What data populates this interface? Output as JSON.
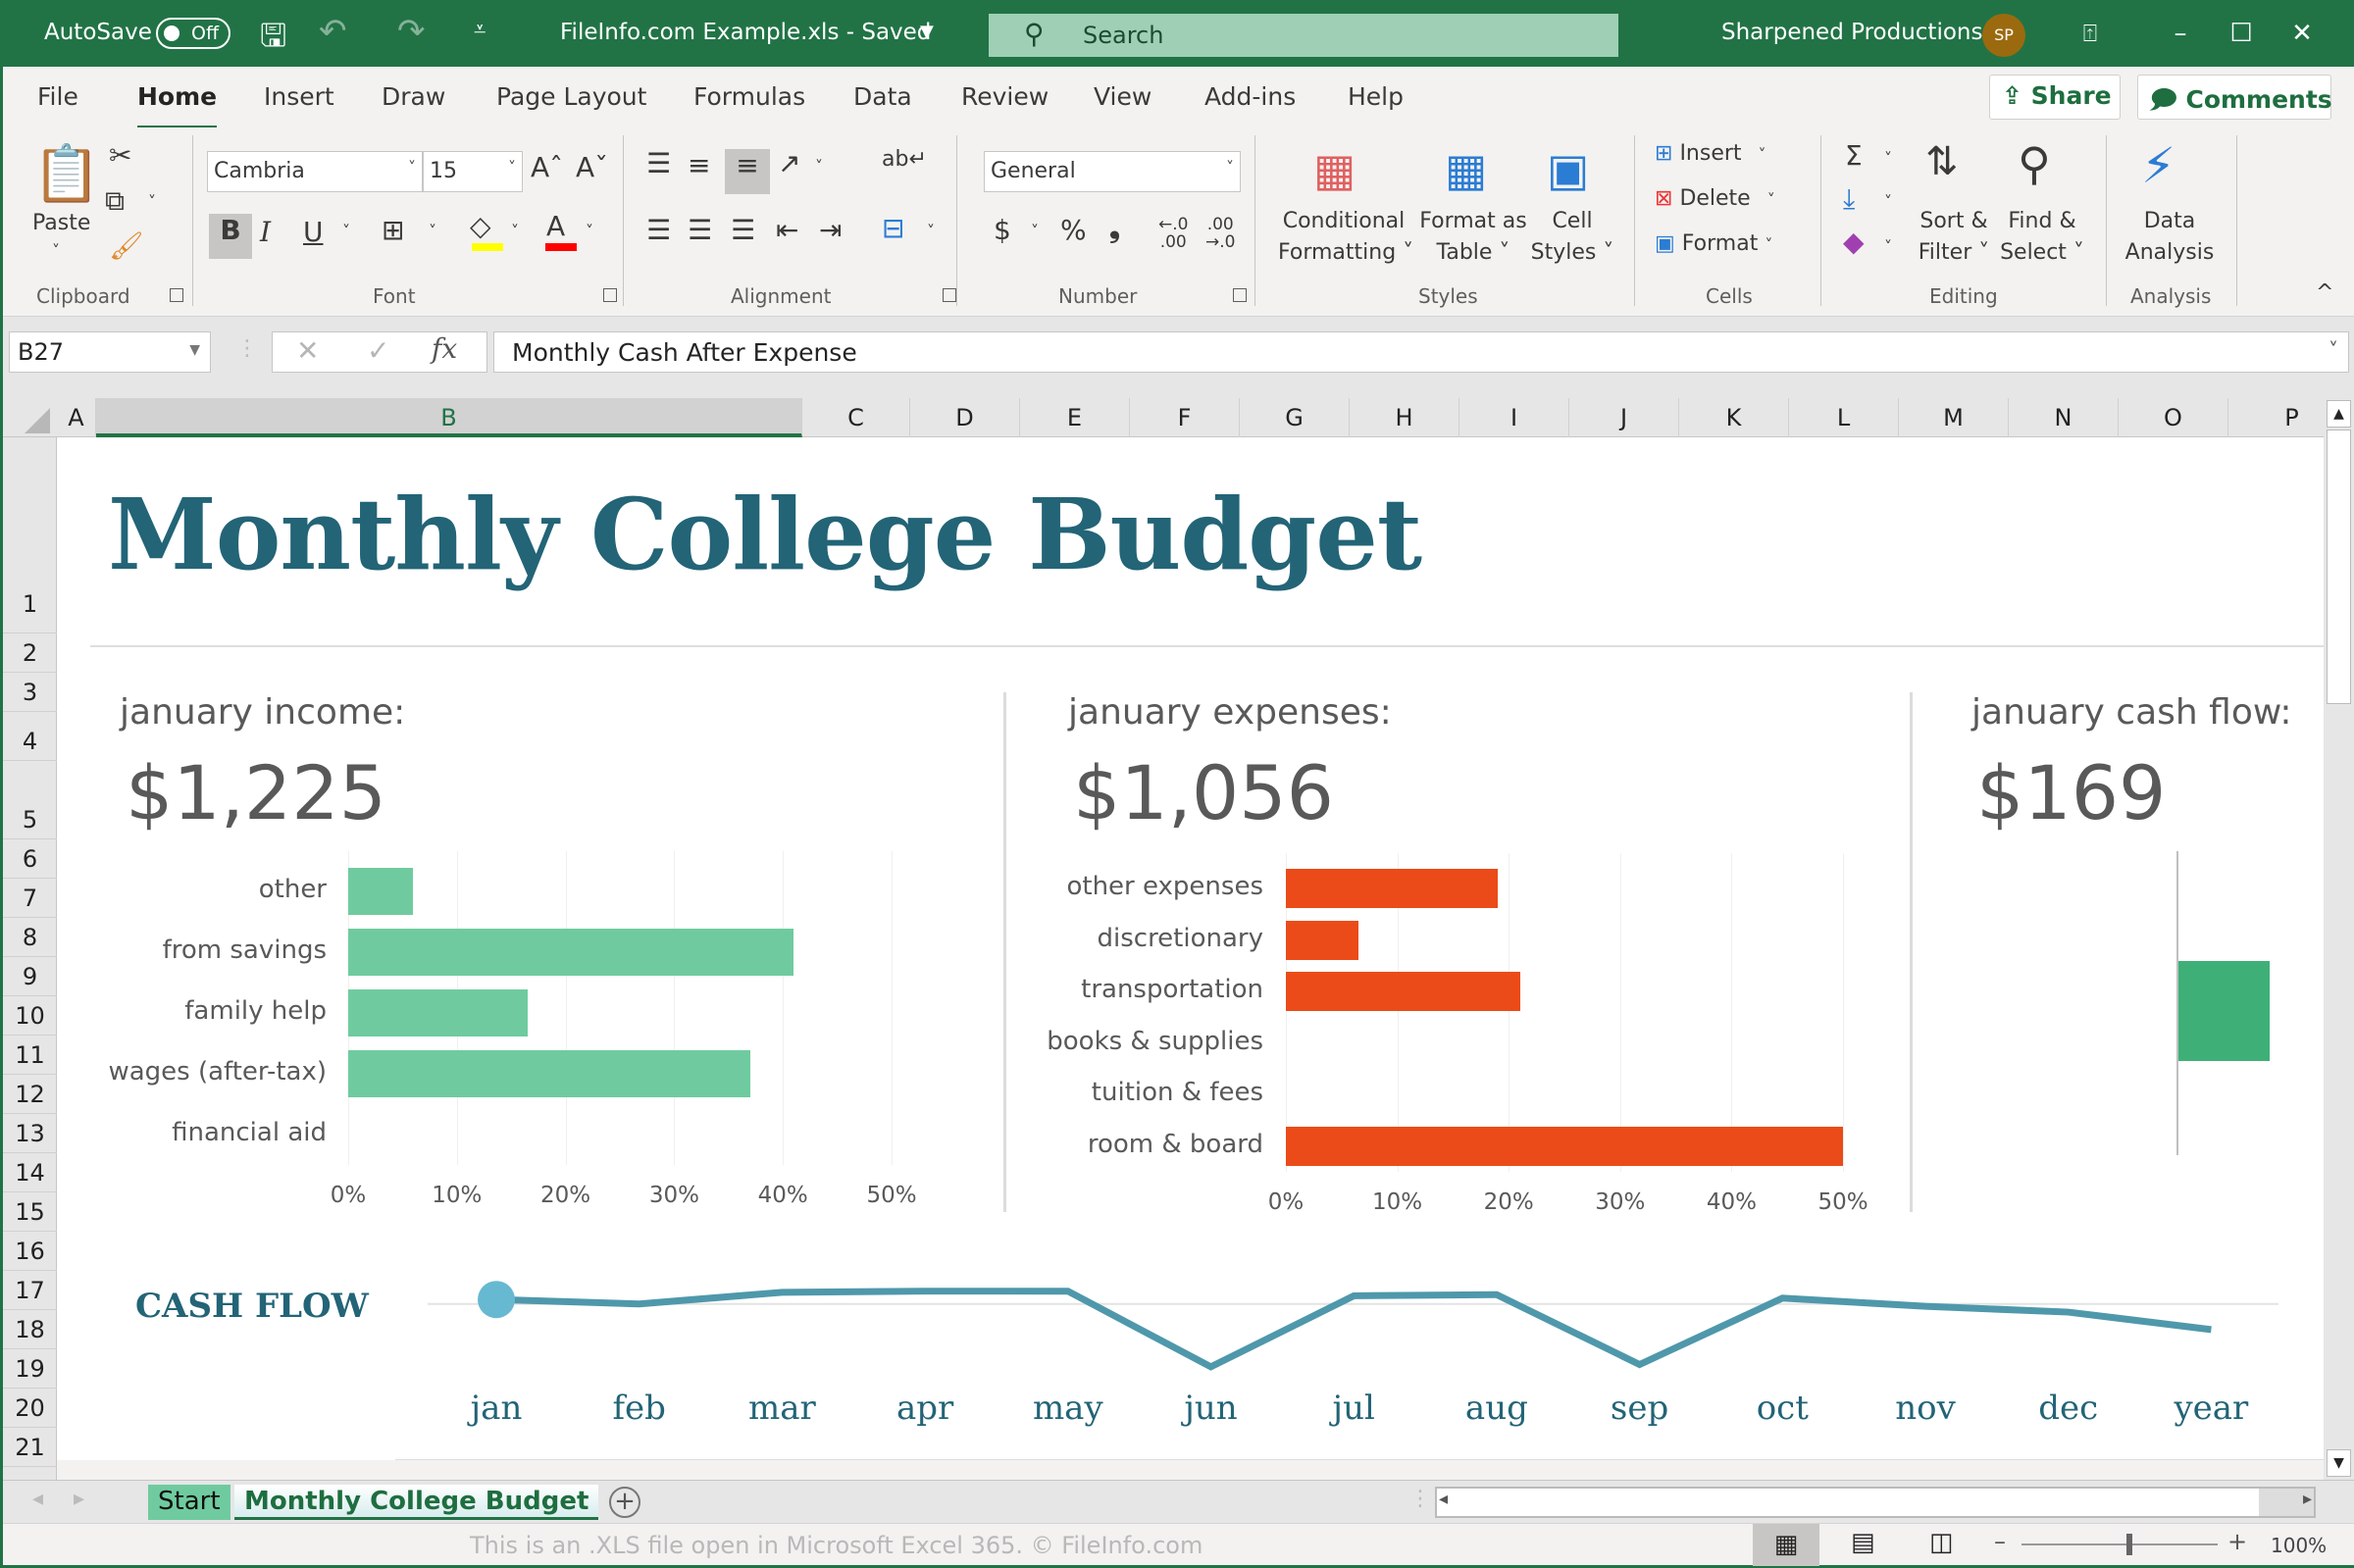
{
  "titlebar": {
    "autosave_label": "AutoSave",
    "autosave_state": "Off",
    "doc_title": "FileInfo.com Example.xls  -  Saved",
    "search_placeholder": "Search",
    "user_name": "Sharpened Productions",
    "user_initials": "SP",
    "colors": {
      "bar": "#217346",
      "search": "#9fd0b5",
      "avatar": "#9b6a0e"
    }
  },
  "menu": {
    "tabs": [
      {
        "label": "File"
      },
      {
        "label": "Home",
        "active": true
      },
      {
        "label": "Insert"
      },
      {
        "label": "Draw"
      },
      {
        "label": "Page Layout"
      },
      {
        "label": "Formulas"
      },
      {
        "label": "Data"
      },
      {
        "label": "Review"
      },
      {
        "label": "View"
      },
      {
        "label": "Add-ins"
      },
      {
        "label": "Help"
      }
    ],
    "share_label": "Share",
    "comments_label": "Comments"
  },
  "ribbon": {
    "clipboard": {
      "label": "Clipboard",
      "paste": "Paste"
    },
    "font": {
      "label": "Font",
      "font_name": "Cambria",
      "font_size": "15",
      "bold": "B",
      "italic": "I",
      "underline": "U",
      "fill_color": "#ffff00",
      "font_color": "#ff0000"
    },
    "alignment": {
      "label": "Alignment"
    },
    "number": {
      "label": "Number",
      "format": "General",
      "currency": "$",
      "percent": "%",
      "comma": "❟"
    },
    "styles": {
      "label": "Styles",
      "conditional": [
        "Conditional",
        "Formatting ˅"
      ],
      "format_table": [
        "Format as",
        "Table ˅"
      ],
      "cell_styles": [
        "Cell",
        "Styles ˅"
      ]
    },
    "cells": {
      "label": "Cells",
      "insert": "Insert",
      "delete": "Delete",
      "format": "Format"
    },
    "editing": {
      "label": "Editing",
      "sort": [
        "Sort &",
        "Filter ˅"
      ],
      "find": [
        "Find &",
        "Select ˅"
      ]
    },
    "analysis": {
      "label": "Analysis",
      "data_analysis": [
        "Data",
        "Analysis"
      ]
    }
  },
  "formula_bar": {
    "name_box": "B27",
    "fx": "fx",
    "formula": "Monthly Cash After Expense"
  },
  "grid": {
    "columns": [
      "A",
      "B",
      "C",
      "D",
      "E",
      "F",
      "G",
      "H",
      "I",
      "J",
      "K",
      "L",
      "M",
      "N",
      "O",
      "P"
    ],
    "selected_column": "B",
    "rows": [
      "1",
      "2",
      "3",
      "4",
      "5",
      "6",
      "7",
      "8",
      "9",
      "10",
      "11",
      "12",
      "13",
      "14",
      "15",
      "16",
      "17",
      "18",
      "19",
      "20",
      "21"
    ]
  },
  "dashboard": {
    "title": "Monthly College Budget",
    "income": {
      "label": "january income:",
      "value": "$1,225"
    },
    "expenses": {
      "label": "january expenses:",
      "value": "$1,056"
    },
    "cashflow": {
      "label": "january cash flow:",
      "value": "$169"
    },
    "cashflow_section_title": "CASH FLOW"
  },
  "chart_data": [
    {
      "type": "bar",
      "orientation": "horizontal",
      "title": "january income",
      "categories": [
        "other",
        "from savings",
        "family help",
        "wages (after-tax)",
        "financial aid"
      ],
      "values": [
        0.06,
        0.41,
        0.165,
        0.37,
        0.0
      ],
      "xlim": [
        0,
        0.5
      ],
      "ticks": [
        "0%",
        "10%",
        "20%",
        "30%",
        "40%",
        "50%"
      ],
      "color": "#6fcb9f",
      "grid": true
    },
    {
      "type": "bar",
      "orientation": "horizontal",
      "title": "january expenses",
      "categories": [
        "other expenses",
        "discretionary",
        "transportation",
        "books & supplies",
        "tuition & fees",
        "room & board"
      ],
      "values": [
        0.19,
        0.065,
        0.21,
        0.0,
        0.0,
        0.5
      ],
      "xlim": [
        0,
        0.5
      ],
      "ticks": [
        "0%",
        "10%",
        "20%",
        "30%",
        "40%",
        "50%"
      ],
      "color": "#eb4b18",
      "grid": true
    },
    {
      "type": "bar",
      "orientation": "horizontal",
      "title": "january cash flow",
      "categories": [
        "cash flow"
      ],
      "values": [
        169
      ],
      "color": "#3faf78"
    },
    {
      "type": "line",
      "title": "CASH FLOW",
      "categories": [
        "jan",
        "feb",
        "mar",
        "apr",
        "may",
        "jun",
        "jul",
        "aug",
        "sep",
        "oct",
        "nov",
        "dec",
        "year"
      ],
      "values": [
        169,
        150,
        200,
        205,
        205,
        -120,
        185,
        190,
        -110,
        175,
        140,
        115,
        40
      ],
      "ylim": [
        -150,
        250
      ],
      "baseline": 150,
      "color": "#4f98ab",
      "marker_color": "#67b9d1",
      "highlight_index": 0
    }
  ],
  "sheet_tabs": {
    "tabs": [
      {
        "label": "Start"
      },
      {
        "label": "Monthly College Budget",
        "active": true
      }
    ],
    "start_color": "#6fcb9f"
  },
  "status_bar": {
    "message": "This is an .XLS file open in Microsoft Excel 365. © FileInfo.com",
    "zoom": "100%",
    "zoom_fraction": 0.55
  }
}
